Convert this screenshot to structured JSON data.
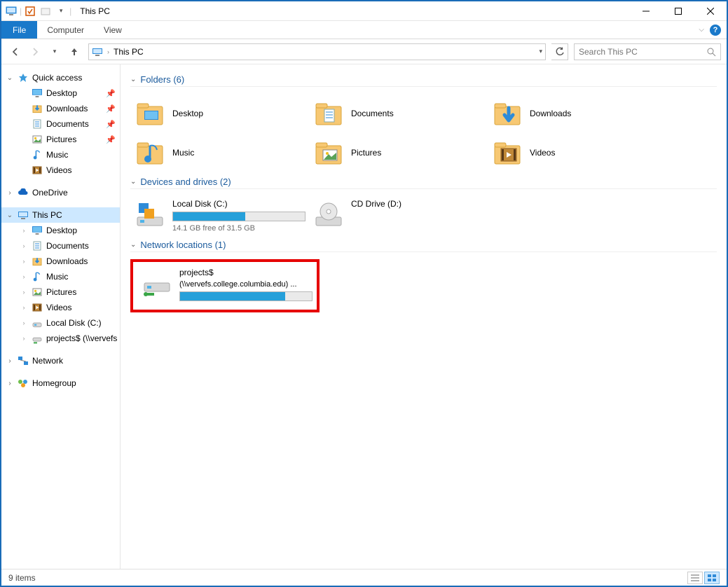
{
  "window": {
    "title": "This PC"
  },
  "ribbon": {
    "file": "File",
    "computer": "Computer",
    "view": "View"
  },
  "nav": {
    "address": "This PC",
    "search_placeholder": "Search This PC"
  },
  "tree": {
    "quick_access": "Quick access",
    "qa_items": [
      {
        "label": "Desktop",
        "icon": "desktop",
        "pinned": true
      },
      {
        "label": "Downloads",
        "icon": "downloads",
        "pinned": true
      },
      {
        "label": "Documents",
        "icon": "documents",
        "pinned": true
      },
      {
        "label": "Pictures",
        "icon": "pictures",
        "pinned": true
      },
      {
        "label": "Music",
        "icon": "music",
        "pinned": false
      },
      {
        "label": "Videos",
        "icon": "videos",
        "pinned": false
      }
    ],
    "onedrive": "OneDrive",
    "this_pc": "This PC",
    "this_pc_items": [
      {
        "label": "Desktop",
        "icon": "desktop"
      },
      {
        "label": "Documents",
        "icon": "documents"
      },
      {
        "label": "Downloads",
        "icon": "downloads"
      },
      {
        "label": "Music",
        "icon": "music"
      },
      {
        "label": "Pictures",
        "icon": "pictures"
      },
      {
        "label": "Videos",
        "icon": "videos"
      },
      {
        "label": "Local Disk (C:)",
        "icon": "drive"
      },
      {
        "label": "projects$ (\\\\vervefs",
        "icon": "netdrive"
      }
    ],
    "network": "Network",
    "homegroup": "Homegroup"
  },
  "sections": {
    "folders": {
      "title": "Folders (6)",
      "items": [
        {
          "label": "Desktop",
          "icon": "desktop"
        },
        {
          "label": "Documents",
          "icon": "documents"
        },
        {
          "label": "Downloads",
          "icon": "downloads"
        },
        {
          "label": "Music",
          "icon": "music"
        },
        {
          "label": "Pictures",
          "icon": "pictures"
        },
        {
          "label": "Videos",
          "icon": "videos"
        }
      ]
    },
    "drives": {
      "title": "Devices and drives (2)",
      "local": {
        "label": "Local Disk (C:)",
        "free": "14.1 GB free of 31.5 GB",
        "fill_pct": 55
      },
      "cd": {
        "label": "CD Drive (D:)"
      }
    },
    "network": {
      "title": "Network locations (1)",
      "share": {
        "label": "projects$",
        "sub": "(\\\\vervefs.college.columbia.edu) ...",
        "fill_pct": 80
      }
    }
  },
  "status": {
    "text": "9 items"
  }
}
